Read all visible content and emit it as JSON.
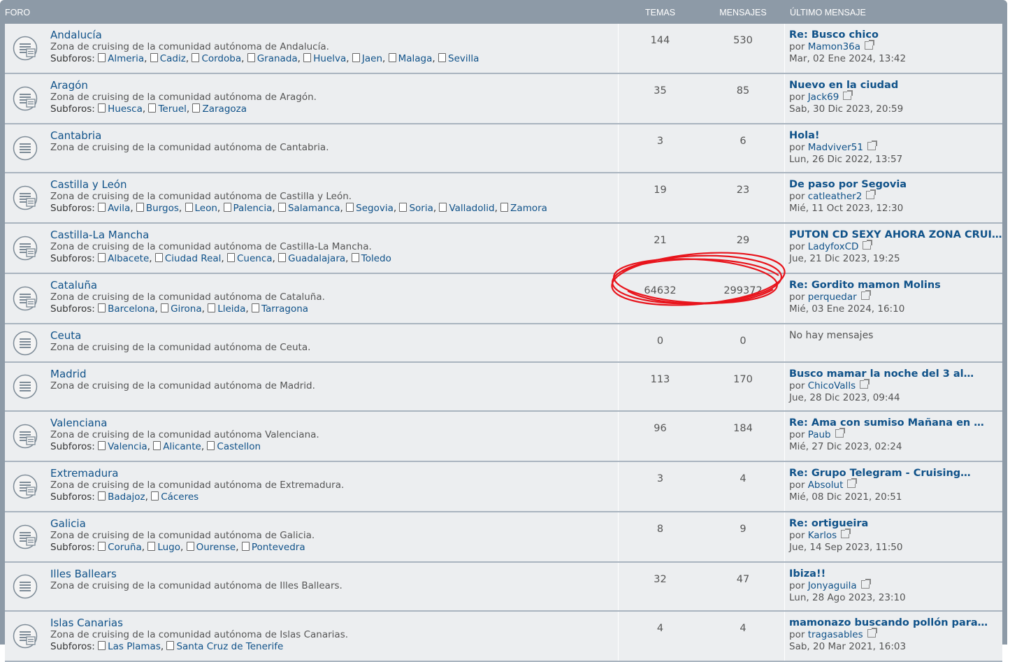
{
  "header": {
    "foro": "Foro",
    "temas": "Temas",
    "mensajes": "Mensajes",
    "ultimo": "Último mensaje"
  },
  "subforos_label": "Subforos:",
  "forums": [
    {
      "title": "Andalucía",
      "desc": "Zona de cruising de la comunidad autónoma de Andalucía.",
      "subforums": [
        "Almeria",
        "Cadiz",
        "Cordoba",
        "Granada",
        "Huelva",
        "Jaen",
        "Malaga",
        "Sevilla"
      ],
      "temas": "144",
      "mensajes": "530",
      "last": {
        "title": "Re: Busco chico",
        "por": "por",
        "author": "Mamon36a",
        "date": "Mar, 02 Ene 2024, 13:42"
      }
    },
    {
      "title": "Aragón",
      "desc": "Zona de cruising de la comunidad autónoma de Aragón.",
      "subforums": [
        "Huesca",
        "Teruel",
        "Zaragoza"
      ],
      "temas": "35",
      "mensajes": "85",
      "last": {
        "title": "Nuevo en la ciudad",
        "por": "por",
        "author": "Jack69",
        "date": "Sab, 30 Dic 2023, 20:59"
      }
    },
    {
      "title": "Cantabria",
      "desc": "Zona de cruising de la comunidad autónoma de Cantabria.",
      "subforums": [],
      "temas": "3",
      "mensajes": "6",
      "last": {
        "title": "Hola!",
        "por": "por",
        "author": "Madviver51",
        "date": "Lun, 26 Dic 2022, 13:57"
      }
    },
    {
      "title": "Castilla y León",
      "desc": "Zona de cruising de la comunidad autónoma de Castilla y León.",
      "subforums": [
        "Avila",
        "Burgos",
        "Leon",
        "Palencia",
        "Salamanca",
        "Segovia",
        "Soria",
        "Valladolid",
        "Zamora"
      ],
      "temas": "19",
      "mensajes": "23",
      "last": {
        "title": "De paso por Segovia",
        "por": "por",
        "author": "catleather2",
        "date": "Mié, 11 Oct 2023, 12:30"
      }
    },
    {
      "title": "Castilla-La Mancha",
      "desc": "Zona de cruising de la comunidad autónoma de Castilla-La Mancha.",
      "subforums": [
        "Albacete",
        "Ciudad Real",
        "Cuenca",
        "Guadalajara",
        "Toledo"
      ],
      "temas": "21",
      "mensajes": "29",
      "last": {
        "title": "PUTON CD SEXY AHORA ZONA CRUI…",
        "por": "por",
        "author": "LadyfoxCD",
        "date": "Jue, 21 Dic 2023, 19:25"
      }
    },
    {
      "title": "Cataluña",
      "desc": "Zona de cruising de la comunidad autónoma de Cataluña.",
      "subforums": [
        "Barcelona",
        "Girona",
        "Lleida",
        "Tarragona"
      ],
      "temas": "64632",
      "mensajes": "299372",
      "last": {
        "title": "Re: Gordito mamon Molins",
        "por": "por",
        "author": "perquedar",
        "date": "Mié, 03 Ene 2024, 16:10"
      }
    },
    {
      "title": "Ceuta",
      "desc": "Zona de cruising de la comunidad autónoma de Ceuta.",
      "subforums": [],
      "temas": "0",
      "mensajes": "0",
      "last": {
        "noposts": "No hay mensajes"
      }
    },
    {
      "title": "Madrid",
      "desc": "Zona de cruising de la comunidad autónoma de Madrid.",
      "subforums": [],
      "temas": "113",
      "mensajes": "170",
      "last": {
        "title": "Busco mamar la noche del 3 al…",
        "por": "por",
        "author": "ChicoValls",
        "date": "Jue, 28 Dic 2023, 09:44"
      }
    },
    {
      "title": "Valenciana",
      "desc": "Zona de cruising de la comunidad autónoma Valenciana.",
      "subforums": [
        "Valencia",
        "Alicante",
        "Castellon"
      ],
      "temas": "96",
      "mensajes": "184",
      "last": {
        "title": "Re: Ama con sumiso Mañana en …",
        "por": "por",
        "author": "Paub",
        "date": "Mié, 27 Dic 2023, 02:24"
      }
    },
    {
      "title": "Extremadura",
      "desc": "Zona de cruising de la comunidad autónoma de Extremadura.",
      "subforums": [
        "Badajoz",
        "Cáceres"
      ],
      "temas": "3",
      "mensajes": "4",
      "last": {
        "title": "Re: Grupo Telegram - Cruising…",
        "por": "por",
        "author": "Absolut",
        "date": "Mié, 08 Dic 2021, 20:51"
      }
    },
    {
      "title": "Galicia",
      "desc": "Zona de cruising de la comunidad autónoma de Galicia.",
      "subforums": [
        "Coruña",
        "Lugo",
        "Ourense",
        "Pontevedra"
      ],
      "temas": "8",
      "mensajes": "9",
      "last": {
        "title": "Re: ortigueira",
        "por": "por",
        "author": "Karlos",
        "date": "Jue, 14 Sep 2023, 11:50"
      }
    },
    {
      "title": "Illes Ballears",
      "desc": "Zona de cruising de la comunidad autónoma de Illes Ballears.",
      "subforums": [],
      "temas": "32",
      "mensajes": "47",
      "last": {
        "title": "Ibiza!!",
        "por": "por",
        "author": "Jonyaguila",
        "date": "Lun, 28 Ago 2023, 23:10"
      }
    },
    {
      "title": "Islas Canarias",
      "desc": "Zona de cruising de la comunidad autónoma de Islas Canarias.",
      "subforums": [
        "Las Plamas",
        "Santa Cruz de Tenerife"
      ],
      "temas": "4",
      "mensajes": "4",
      "last": {
        "title": "mamonazo buscando pollón para…",
        "por": "por",
        "author": "tragasables",
        "date": "Sab, 20 Mar 2021, 16:03"
      }
    }
  ],
  "annotation": {
    "color": "#e8141c"
  },
  "colors": {
    "header_bg": "#8d9aa7",
    "row_bg": "#eceef0",
    "link": "#105289"
  }
}
